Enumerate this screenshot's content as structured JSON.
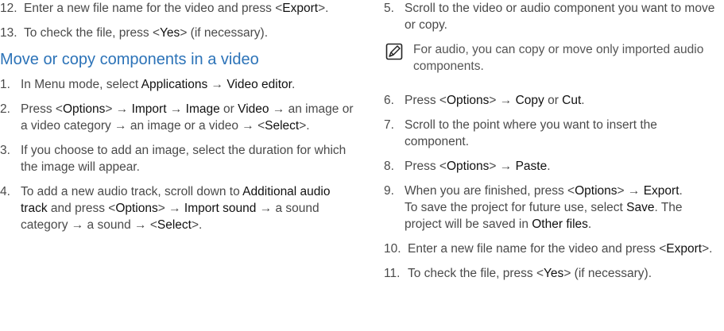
{
  "left": {
    "steps_top": [
      {
        "num": "12.",
        "parts": [
          {
            "t": "Enter a new file name for the video and press <"
          },
          {
            "t": "Export",
            "b": true
          },
          {
            "t": ">."
          }
        ]
      },
      {
        "num": "13.",
        "parts": [
          {
            "t": "To check the file, press <"
          },
          {
            "t": "Yes",
            "b": true
          },
          {
            "t": "> (if necessary)."
          }
        ]
      }
    ],
    "heading": "Move or copy components in a video",
    "steps": [
      {
        "num": "1.",
        "parts": [
          {
            "t": "In Menu mode, select "
          },
          {
            "t": "Applications",
            "b": true
          },
          {
            "t": " → "
          },
          {
            "t": "Video editor",
            "b": true
          },
          {
            "t": "."
          }
        ]
      },
      {
        "num": "2.",
        "parts": [
          {
            "t": "Press <"
          },
          {
            "t": "Options",
            "b": true
          },
          {
            "t": "> → "
          },
          {
            "t": "Import",
            "b": true
          },
          {
            "t": " → "
          },
          {
            "t": "Image",
            "b": true
          },
          {
            "t": " or "
          },
          {
            "t": "Video",
            "b": true
          },
          {
            "t": " → an image or a video category → an image or a video → <"
          },
          {
            "t": "Select",
            "b": true
          },
          {
            "t": ">."
          }
        ]
      },
      {
        "num": "3.",
        "parts": [
          {
            "t": "If you choose to add an image, select the duration for which the image will appear."
          }
        ]
      },
      {
        "num": "4.",
        "parts": [
          {
            "t": "To add a new audio track, scroll down to "
          },
          {
            "t": "Additional audio track",
            "b": true
          },
          {
            "t": " and press <"
          },
          {
            "t": "Options",
            "b": true
          },
          {
            "t": "> → "
          },
          {
            "t": "Import sound",
            "b": true
          },
          {
            "t": " → a sound category → a sound → <"
          },
          {
            "t": "Select",
            "b": true
          },
          {
            "t": ">."
          }
        ]
      }
    ]
  },
  "right": {
    "step5": {
      "num": "5.",
      "parts": [
        {
          "t": "Scroll to the video or audio component you want to move or copy."
        }
      ]
    },
    "note": "For audio, you can copy or move only imported audio components.",
    "steps": [
      {
        "num": "6.",
        "parts": [
          {
            "t": "Press <"
          },
          {
            "t": "Options",
            "b": true
          },
          {
            "t": "> → "
          },
          {
            "t": "Copy",
            "b": true
          },
          {
            "t": " or "
          },
          {
            "t": "Cut",
            "b": true
          },
          {
            "t": "."
          }
        ]
      },
      {
        "num": "7.",
        "parts": [
          {
            "t": "Scroll to the point where you want to insert the component."
          }
        ]
      },
      {
        "num": "8.",
        "parts": [
          {
            "t": "Press <"
          },
          {
            "t": "Options",
            "b": true
          },
          {
            "t": "> → "
          },
          {
            "t": "Paste",
            "b": true
          },
          {
            "t": "."
          }
        ]
      },
      {
        "num": "9.",
        "parts": [
          {
            "t": "When you are finished, press <"
          },
          {
            "t": "Options",
            "b": true
          },
          {
            "t": "> → "
          },
          {
            "t": "Export",
            "b": true
          },
          {
            "t": "."
          },
          {
            "br": true
          },
          {
            "t": "To save the project for future use, select "
          },
          {
            "t": "Save",
            "b": true
          },
          {
            "t": ". The project will be saved in "
          },
          {
            "t": "Other files",
            "b": true
          },
          {
            "t": "."
          }
        ]
      },
      {
        "num": "10.",
        "parts": [
          {
            "t": "Enter a new file name for the video and press <"
          },
          {
            "t": "Export",
            "b": true
          },
          {
            "t": ">."
          }
        ]
      },
      {
        "num": "11.",
        "parts": [
          {
            "t": "To check the file, press <"
          },
          {
            "t": "Yes",
            "b": true
          },
          {
            "t": "> (if necessary)."
          }
        ]
      }
    ]
  }
}
